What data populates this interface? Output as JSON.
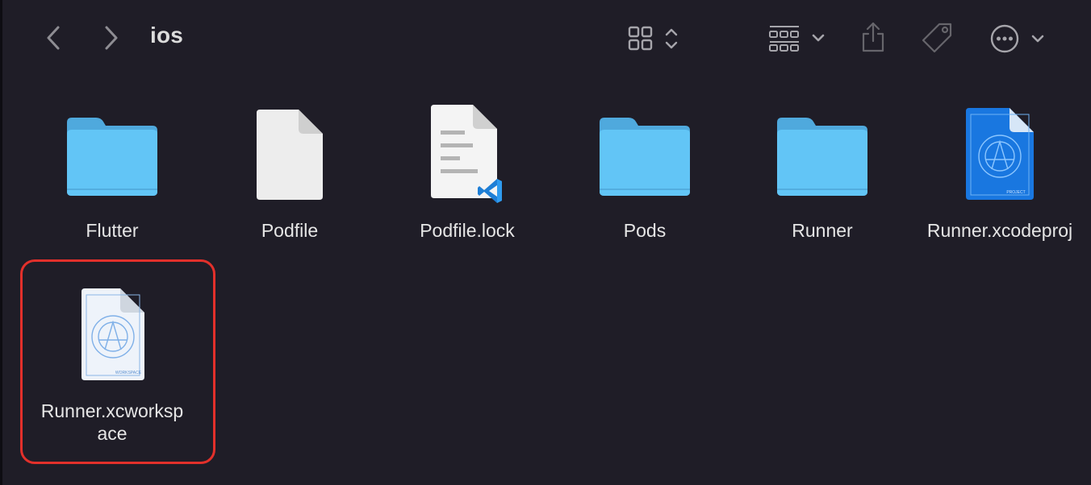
{
  "window": {
    "title": "ios"
  },
  "toolbar": {
    "back": "chevron-left-icon",
    "forward": "chevron-right-icon",
    "view_mode": "grid-view-icon",
    "group": "group-icon",
    "share": "share-icon",
    "tag": "tag-icon",
    "more": "ellipsis-icon"
  },
  "files": [
    {
      "name": "Flutter",
      "kind": "folder"
    },
    {
      "name": "Podfile",
      "kind": "document"
    },
    {
      "name": "Podfile.lock",
      "kind": "vscode-document"
    },
    {
      "name": "Pods",
      "kind": "folder"
    },
    {
      "name": "Runner",
      "kind": "folder"
    },
    {
      "name": "Runner.xcodeproj",
      "kind": "xcode-project"
    },
    {
      "name": "Runner.xcworksp",
      "name2": "ace",
      "kind": "xcode-workspace",
      "selected": true
    }
  ],
  "icon_labels": {
    "project": "PROJECT",
    "workspace": "WORKSPACE"
  },
  "colors": {
    "background": "#1f1d27",
    "folder": "#5fc3f5",
    "selection": "#e2302b",
    "text": "#e6e6e6"
  }
}
